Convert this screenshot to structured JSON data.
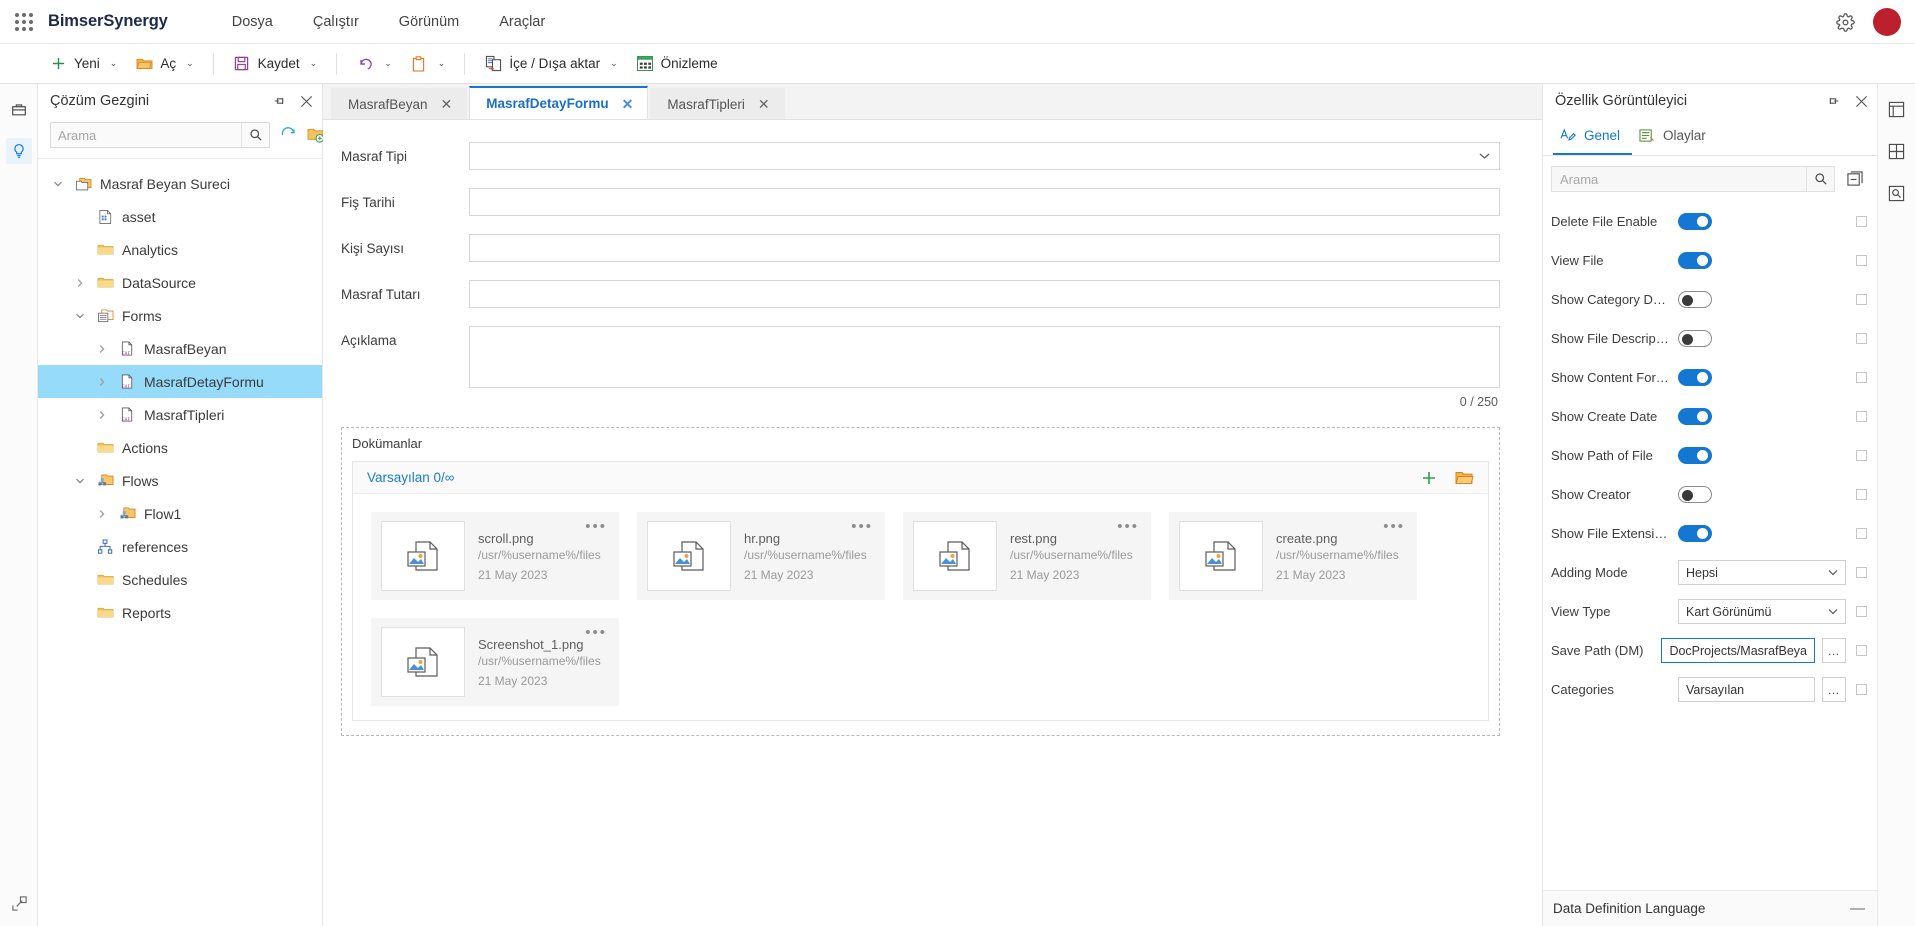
{
  "topbar": {
    "brand": "BimserSynergy",
    "menus": [
      {
        "label": "Dosya"
      },
      {
        "label": "Çalıştır"
      },
      {
        "label": "Görünüm"
      },
      {
        "label": "Araçlar"
      }
    ],
    "settings_icon": "gear-icon",
    "avatar_color": "#bc1f2e"
  },
  "ribbon": {
    "buttons": [
      {
        "label": "Yeni",
        "icon": "plus-icon",
        "caret": "⌄"
      },
      {
        "label": "Aç",
        "icon": "open-folder-icon",
        "caret": "⌄"
      },
      {
        "label": "Kaydet",
        "icon": "save-disk-icon",
        "caret": "⌄"
      },
      {
        "label": "",
        "icon": "undo-icon",
        "caret": "⌄"
      },
      {
        "label": "",
        "icon": "clipboard-icon",
        "caret": "⌄"
      },
      {
        "label": "İçe / Dışa aktar",
        "icon": "import-export-icon",
        "caret": "⌄"
      },
      {
        "label": "Önizleme",
        "icon": "preview-grid-icon",
        "caret": ""
      }
    ]
  },
  "solution": {
    "title": "Çözüm Gezgini",
    "search_placeholder": "Arama",
    "search_value": "",
    "tree": [
      {
        "label": "Masraf Beyan Sureci",
        "depth": 0,
        "twisty": "down",
        "icon": "project-folder-icon",
        "selected": false
      },
      {
        "label": "asset",
        "depth": 1,
        "twisty": "",
        "icon": "asset-file-icon",
        "selected": false
      },
      {
        "label": "Analytics",
        "depth": 1,
        "twisty": "",
        "icon": "folder-icon",
        "selected": false
      },
      {
        "label": "DataSource",
        "depth": 1,
        "twisty": "right",
        "icon": "folder-icon",
        "selected": false
      },
      {
        "label": "Forms",
        "depth": 1,
        "twisty": "down",
        "icon": "forms-folder-icon",
        "selected": false
      },
      {
        "label": "MasrafBeyan",
        "depth": 2,
        "twisty": "right",
        "icon": "eaf-file-icon",
        "selected": false
      },
      {
        "label": "MasrafDetayFormu",
        "depth": 2,
        "twisty": "right",
        "icon": "eaf-file-icon",
        "selected": true
      },
      {
        "label": "MasrafTipleri",
        "depth": 2,
        "twisty": "right",
        "icon": "eaf-file-icon",
        "selected": false
      },
      {
        "label": "Actions",
        "depth": 1,
        "twisty": "",
        "icon": "folder-icon",
        "selected": false
      },
      {
        "label": "Flows",
        "depth": 1,
        "twisty": "down",
        "icon": "flows-folder-icon",
        "selected": false
      },
      {
        "label": "Flow1",
        "depth": 2,
        "twisty": "right",
        "icon": "flows-folder-icon",
        "selected": false
      },
      {
        "label": "references",
        "depth": 1,
        "twisty": "",
        "icon": "references-icon",
        "selected": false
      },
      {
        "label": "Schedules",
        "depth": 1,
        "twisty": "",
        "icon": "folder-icon",
        "selected": false
      },
      {
        "label": "Reports",
        "depth": 1,
        "twisty": "",
        "icon": "folder-icon",
        "selected": false
      }
    ]
  },
  "tabs": [
    {
      "label": "MasrafBeyan",
      "active": false
    },
    {
      "label": "MasrafDetayFormu",
      "active": true
    },
    {
      "label": "MasrafTipleri",
      "active": false
    }
  ],
  "form": {
    "fields": [
      {
        "label": "Masraf Tipi",
        "type": "dropdown",
        "value": ""
      },
      {
        "label": "Fiş Tarihi",
        "type": "text",
        "value": ""
      },
      {
        "label": "Kişi Sayısı",
        "type": "text",
        "value": ""
      },
      {
        "label": "Masraf Tutarı",
        "type": "text",
        "value": ""
      },
      {
        "label": "Açıklama",
        "type": "textarea",
        "value": ""
      }
    ],
    "char_counter": "0 / 250"
  },
  "documents": {
    "section_title": "Dokümanlar",
    "group_title": "Varsayılan 0/∞",
    "add_icon": "plus-icon",
    "folder_icon": "open-folder-icon",
    "files": [
      {
        "name": "scroll.png",
        "path": "/usr/%username%/files",
        "date": "21 May 2023"
      },
      {
        "name": "hr.png",
        "path": "/usr/%username%/files",
        "date": "21 May 2023"
      },
      {
        "name": "rest.png",
        "path": "/usr/%username%/files",
        "date": "21 May 2023"
      },
      {
        "name": "create.png",
        "path": "/usr/%username%/files",
        "date": "21 May 2023"
      },
      {
        "name": "Screenshot_1.png",
        "path": "/usr/%username%/files",
        "date": "21 May 2023"
      }
    ]
  },
  "properties": {
    "title": "Özellik Görüntüleyici",
    "tabs": [
      {
        "label": "Genel",
        "icon": "properties-icon",
        "active": true
      },
      {
        "label": "Olaylar",
        "icon": "events-icon",
        "active": false
      }
    ],
    "search_placeholder": "Arama",
    "search_value": "",
    "rows": [
      {
        "name": "Delete File Enable",
        "kind": "toggle",
        "value": "on"
      },
      {
        "name": "View File",
        "kind": "toggle",
        "value": "on"
      },
      {
        "name": "Show Category Desc...",
        "kind": "toggle",
        "value": "off"
      },
      {
        "name": "Show File Description",
        "kind": "toggle",
        "value": "off"
      },
      {
        "name": "Show Content For I...",
        "kind": "toggle",
        "value": "on"
      },
      {
        "name": "Show Create Date",
        "kind": "toggle",
        "value": "on"
      },
      {
        "name": "Show Path of File",
        "kind": "toggle",
        "value": "on"
      },
      {
        "name": "Show Creator",
        "kind": "toggle",
        "value": "off"
      },
      {
        "name": "Show File Extension I...",
        "kind": "toggle",
        "value": "on"
      },
      {
        "name": "Adding Mode",
        "kind": "select",
        "value": "Hepsi"
      },
      {
        "name": "View Type",
        "kind": "select",
        "value": "Kart Görünümü"
      },
      {
        "name": "Save Path (DM)",
        "kind": "text-dots",
        "value": "DocProjects/MasrafBeya",
        "focused": true
      },
      {
        "name": "Categories",
        "kind": "text-dots",
        "value": "Varsayılan",
        "focused": false
      }
    ],
    "section": {
      "label": "Data Definition Language",
      "collapse_glyph": "—"
    }
  },
  "colors": {
    "accent": "#1477d1",
    "tree_selection": "#96dcfa",
    "toggle_on": "#1477d1",
    "avatar": "#bc1f2e",
    "link": "#1b7ad1"
  }
}
